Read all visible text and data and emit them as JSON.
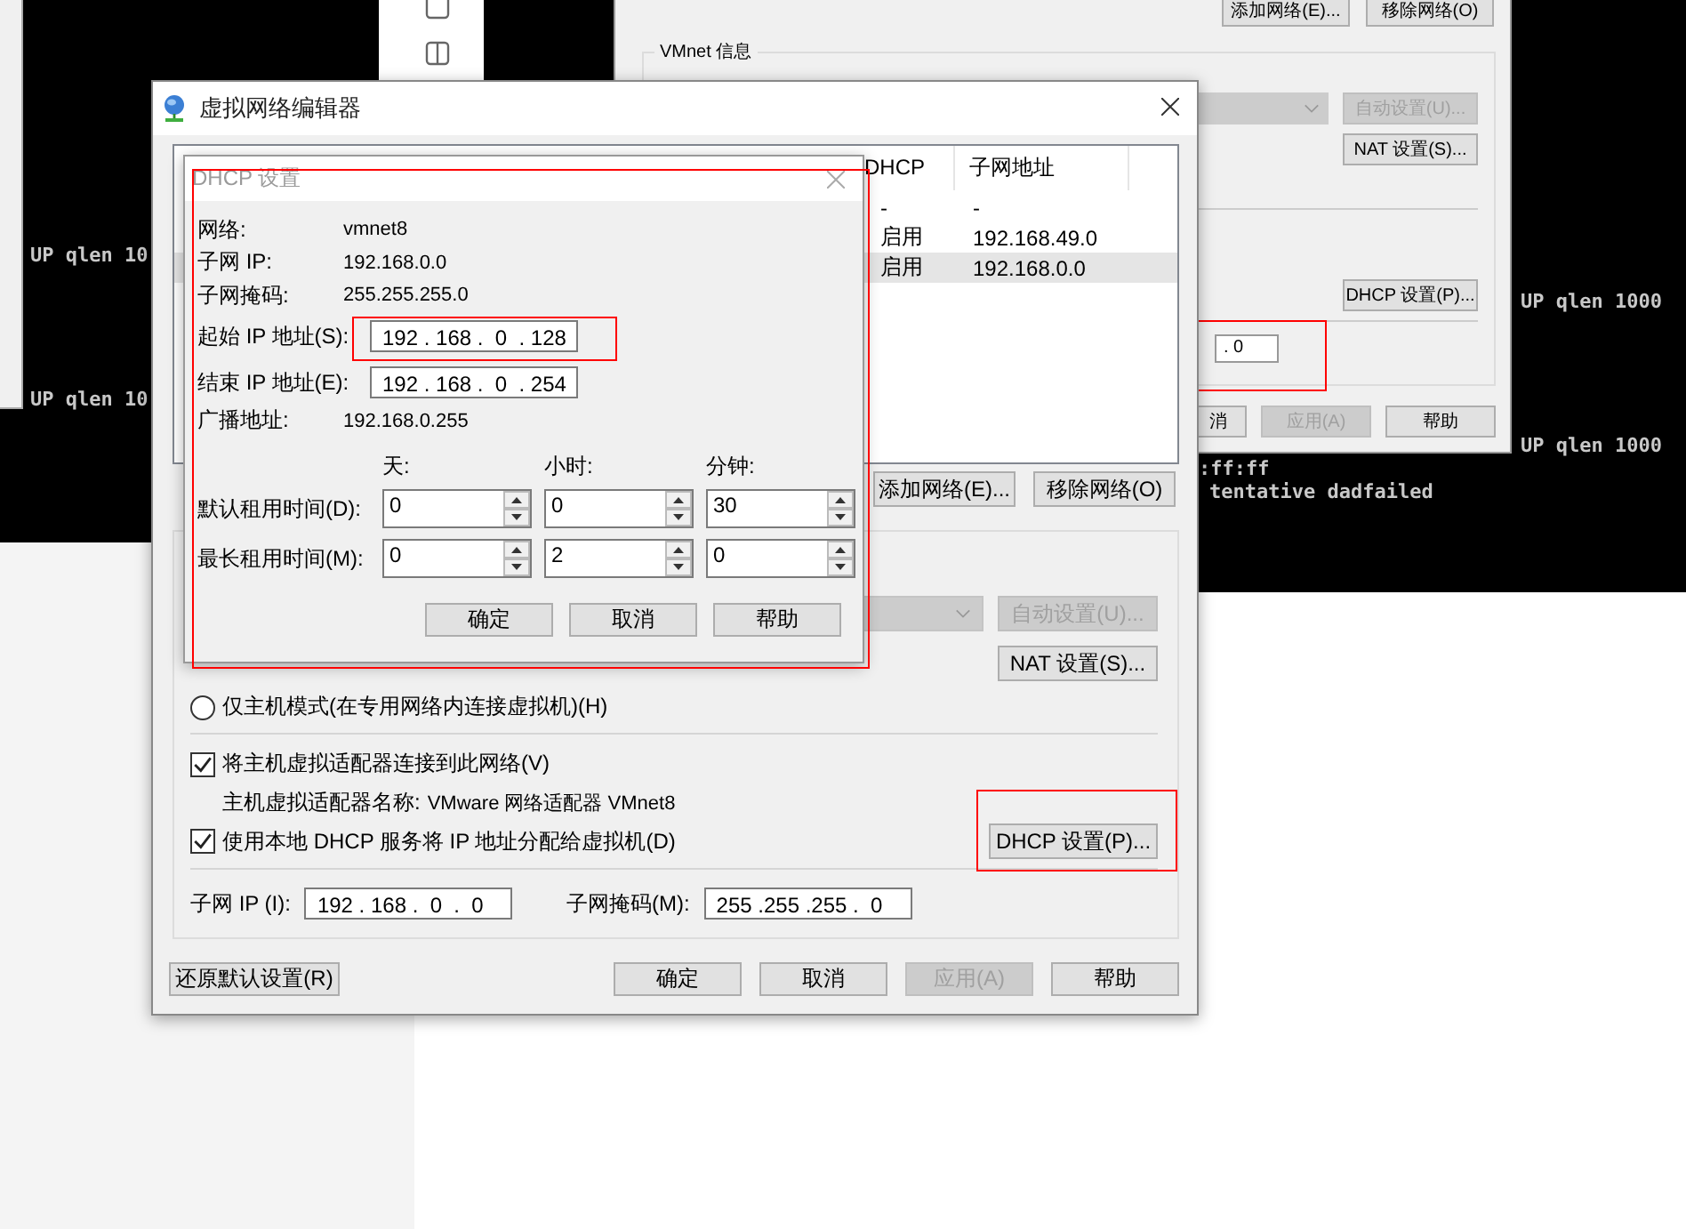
{
  "terminal": {
    "left_lines": [
      "UP qlen 10",
      "UP qlen 10"
    ],
    "right_lines": [
      "UP qlen 1000",
      "UP qlen 1000"
    ],
    "lower_lines": [
      ":ff:ff",
      "tentative dadfailed"
    ]
  },
  "back_window": {
    "top_buttons": [
      {
        "label": "添加网络(E)..."
      },
      {
        "label": "移除网络(O)"
      }
    ],
    "group_title": "VMnet 信息",
    "auto_button": {
      "label": "自动设置(U)...",
      "disabled": true
    },
    "nat_button": {
      "label": "NAT 设置(S)..."
    },
    "dhcp_button": {
      "label": "DHCP 设置(P)..."
    },
    "mask_field": {
      "value": ". 0"
    },
    "footer_buttons": [
      {
        "label": "消",
        "disabled": false
      },
      {
        "label": "应用(A)",
        "disabled": true
      },
      {
        "label": "帮助",
        "disabled": false
      }
    ]
  },
  "main_dialog": {
    "title": "虚拟网络编辑器",
    "table": {
      "columns": [
        "DHCP",
        "子网地址"
      ],
      "rows": [
        {
          "cells": [
            "-",
            "-"
          ],
          "selected": false
        },
        {
          "cells": [
            "启用",
            "192.168.49.0"
          ],
          "selected": false
        },
        {
          "cells": [
            "启用",
            "192.168.0.0"
          ],
          "selected": true
        }
      ]
    },
    "list_buttons": [
      {
        "label": "添加网络(E)..."
      },
      {
        "label": "移除网络(O)"
      }
    ],
    "auto_button": {
      "label": "自动设置(U)...",
      "disabled": true
    },
    "nat_button": {
      "label": "NAT 设置(S)..."
    },
    "host_only": {
      "label": "仅主机模式(在专用网络内连接虚拟机)(H)",
      "selected": false
    },
    "connect_adapter": {
      "label": "将主机虚拟适配器连接到此网络(V)",
      "checked": true
    },
    "adapter_name": {
      "label": "主机虚拟适配器名称:",
      "value": "VMware 网络适配器 VMnet8"
    },
    "use_dhcp": {
      "label": "使用本地 DHCP 服务将 IP 地址分配给虚拟机(D)",
      "checked": true
    },
    "dhcp_button": {
      "label": "DHCP 设置(P)..."
    },
    "subnet_ip": {
      "label": "子网 IP (I):",
      "value": "192 . 168 .  0  .  0"
    },
    "subnet_mask": {
      "label": "子网掩码(M):",
      "value": "255 .255 .255 .  0"
    },
    "restore_button": {
      "label": "还原默认设置(R)"
    },
    "footer_buttons": [
      {
        "label": "确定",
        "disabled": false
      },
      {
        "label": "取消",
        "disabled": false
      },
      {
        "label": "应用(A)",
        "disabled": true
      },
      {
        "label": "帮助",
        "disabled": false
      }
    ]
  },
  "dhcp_dialog": {
    "title": "DHCP 设置",
    "info": [
      {
        "label": "网络:",
        "value": "vmnet8"
      },
      {
        "label": "子网 IP:",
        "value": "192.168.0.0"
      },
      {
        "label": "子网掩码:",
        "value": "255.255.255.0"
      }
    ],
    "start_ip": {
      "label": "起始 IP 地址(S):",
      "value": "192 . 168 .  0  . 128"
    },
    "end_ip": {
      "label": "结束 IP 地址(E):",
      "value": "192 . 168 .  0  . 254"
    },
    "broadcast": {
      "label": "广播地址:",
      "value": "192.168.0.255"
    },
    "lease_headers": [
      "天:",
      "小时:",
      "分钟:"
    ],
    "lease_rows": [
      {
        "label": "默认租用时间(D):",
        "values": [
          "0",
          "0",
          "30"
        ]
      },
      {
        "label": "最长租用时间(M):",
        "values": [
          "0",
          "2",
          "0"
        ]
      }
    ],
    "buttons": [
      {
        "label": "确定"
      },
      {
        "label": "取消"
      },
      {
        "label": "帮助"
      }
    ]
  }
}
